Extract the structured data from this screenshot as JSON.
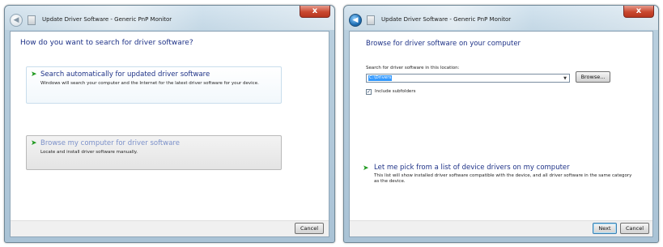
{
  "left_window": {
    "title": "Update Driver Software - Generic PnP Monitor",
    "close_label": "x",
    "heading": "How do you want to search for driver software?",
    "option_auto": {
      "title": "Search automatically for updated driver software",
      "description": "Windows will search your computer and the Internet for the latest driver software for your device."
    },
    "option_browse": {
      "title": "Browse my computer for driver software",
      "description": "Locate and install driver software manually."
    },
    "cancel_label": "Cancel"
  },
  "right_window": {
    "title": "Update Driver Software - Generic PnP Monitor",
    "close_label": "x",
    "heading": "Browse for driver software on your computer",
    "search_label": "Search for driver software in this location:",
    "path_value": "C:\\Drivers",
    "browse_label": "Browse...",
    "include_subfolders_label": "Include subfolders",
    "include_subfolders_checked": true,
    "pick_option": {
      "title": "Let me pick from a list of device drivers on my computer",
      "description": "This list will show installed driver software compatible with the device, and all driver software in the same category as the device."
    },
    "next_label": "Next",
    "cancel_label": "Cancel"
  },
  "icons": {
    "back": "back-arrow",
    "option_arrow": "green-arrow",
    "wizard": "wizard-icon"
  },
  "colors": {
    "heading_blue": "#1e3287",
    "muted_link": "#7b90c9",
    "arrow_green": "#1f9a1f",
    "selection_blue": "#3399ff",
    "close_red": "#c9482f"
  }
}
